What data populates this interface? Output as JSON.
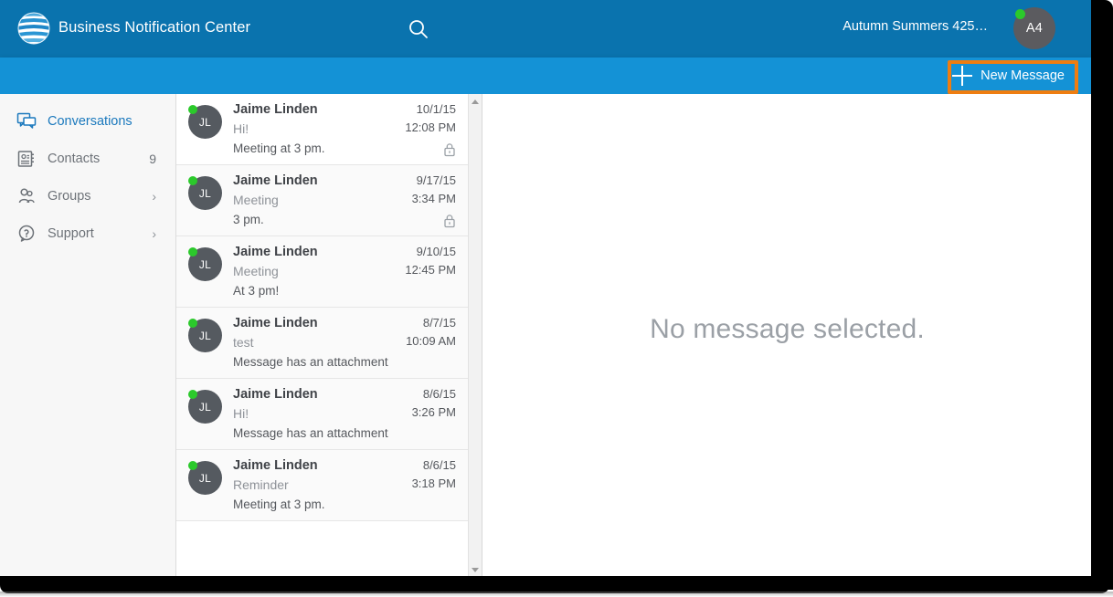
{
  "header": {
    "logo_icon": "att-globe-logo",
    "app_title": "Business Notification Center",
    "search_icon": "search-icon",
    "user_name": "Autumn Summers 425…",
    "user_avatar_initials": "A4",
    "user_status": "online",
    "bg_color": "#0a73ae"
  },
  "actionbar": {
    "new_message_label": "New Message",
    "plus_icon": "plus-icon",
    "bg_color": "#1492d6",
    "highlight_color": "#ee7d11"
  },
  "sidebar": {
    "items": [
      {
        "label": "Conversations",
        "icon": "conversations-icon",
        "badge": "",
        "chevron": false,
        "active": true
      },
      {
        "label": "Contacts",
        "icon": "contacts-book-icon",
        "badge": "9",
        "chevron": false,
        "active": false
      },
      {
        "label": "Groups",
        "icon": "groups-people-icon",
        "badge": "",
        "chevron": true,
        "active": false
      },
      {
        "label": "Support",
        "icon": "support-question-icon",
        "badge": "",
        "chevron": true,
        "active": false
      }
    ],
    "chevron_glyph": "›",
    "active_color": "#1b79bd"
  },
  "message_list": {
    "items": [
      {
        "avatar_initials": "JL",
        "status": "online",
        "sender": "Jaime Linden",
        "subject": "Hi!",
        "preview": "Meeting at 3 pm.",
        "date": "10/1/15",
        "time": "12:08 PM",
        "locked": true,
        "highlighted": true
      },
      {
        "avatar_initials": "JL",
        "status": "online",
        "sender": "Jaime Linden",
        "subject": "Meeting",
        "preview": "3 pm.",
        "date": "9/17/15",
        "time": "3:34 PM",
        "locked": true,
        "highlighted": false
      },
      {
        "avatar_initials": "JL",
        "status": "online",
        "sender": "Jaime Linden",
        "subject": "Meeting",
        "preview": "At 3 pm!",
        "date": "9/10/15",
        "time": "12:45 PM",
        "locked": false,
        "highlighted": false
      },
      {
        "avatar_initials": "JL",
        "status": "online",
        "sender": "Jaime Linden",
        "subject": "test",
        "preview": "Message has an attachment",
        "date": "8/7/15",
        "time": "10:09 AM",
        "locked": false,
        "highlighted": false
      },
      {
        "avatar_initials": "JL",
        "status": "online",
        "sender": "Jaime Linden",
        "subject": "Hi!",
        "preview": "Message has an attachment",
        "date": "8/6/15",
        "time": "3:26 PM",
        "locked": false,
        "highlighted": false
      },
      {
        "avatar_initials": "JL",
        "status": "online",
        "sender": "Jaime Linden",
        "subject": "Reminder",
        "preview": "Meeting at 3 pm.",
        "date": "8/6/15",
        "time": "3:18 PM",
        "locked": false,
        "highlighted": false
      }
    ],
    "lock_icon": "lock-icon",
    "status_dot_color": "#2bc92b",
    "avatar_color": "#555a60"
  },
  "scrollbar": {
    "up_arrow_icon": "scroll-up-arrow-icon",
    "down_arrow_icon": "scroll-down-arrow-icon"
  },
  "detail": {
    "empty_message": "No message selected."
  }
}
